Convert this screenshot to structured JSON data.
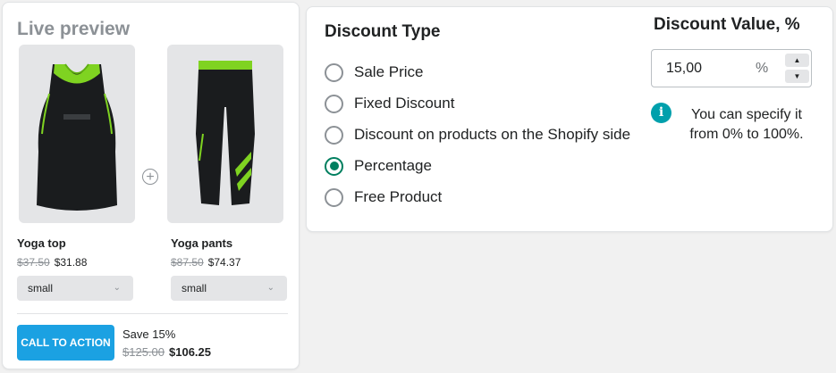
{
  "preview": {
    "title": "Live preview",
    "products": [
      {
        "name": "Yoga top",
        "old_price": "$37.50",
        "new_price": "$31.88",
        "size": "small"
      },
      {
        "name": "Yoga pants",
        "old_price": "$87.50",
        "new_price": "$74.37",
        "size": "small"
      }
    ],
    "cta_label": "CALL TO ACTION",
    "save_text": "Save 15%",
    "total_old": "$125.00",
    "total_new": "$106.25"
  },
  "discount_type": {
    "title": "Discount Type",
    "options": [
      {
        "label": "Sale Price",
        "checked": false
      },
      {
        "label": "Fixed Discount",
        "checked": false
      },
      {
        "label": "Discount on products on the Shopify side",
        "checked": false
      },
      {
        "label": "Percentage",
        "checked": true
      },
      {
        "label": "Free Product",
        "checked": false
      }
    ]
  },
  "discount_value": {
    "title": "Discount Value, %",
    "value": "15,00",
    "unit": "%",
    "info_line1": "You can specify it",
    "info_line2": "from 0% to 100%."
  },
  "colors": {
    "accent_green": "#007f5f",
    "cta_blue": "#1ba1e2",
    "info_teal": "#00a0ac"
  }
}
